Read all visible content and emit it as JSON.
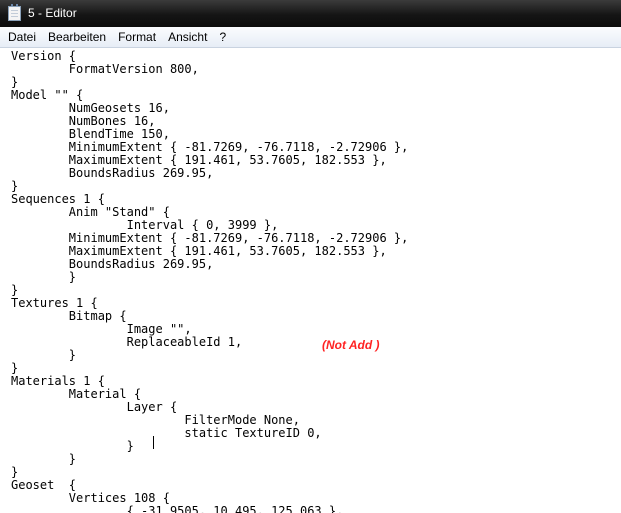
{
  "window": {
    "title": "5 - Editor"
  },
  "menu": [
    "Datei",
    "Bearbeiten",
    "Format",
    "Ansicht",
    "?"
  ],
  "editor_lines": [
    "Version {",
    "\tFormatVersion 800,",
    "}",
    "Model \"\" {",
    "\tNumGeosets 16,",
    "\tNumBones 16,",
    "\tBlendTime 150,",
    "\tMinimumExtent { -81.7269, -76.7118, -2.72906 },",
    "\tMaximumExtent { 191.461, 53.7605, 182.553 },",
    "\tBoundsRadius 269.95,",
    "}",
    "Sequences 1 {",
    "\tAnim \"Stand\" {",
    "\t\tInterval { 0, 3999 },",
    "\tMinimumExtent { -81.7269, -76.7118, -2.72906 },",
    "\tMaximumExtent { 191.461, 53.7605, 182.553 },",
    "\tBoundsRadius 269.95,",
    "\t}",
    "}",
    "Textures 1 {",
    "\tBitmap {",
    "\t\tImage \"\",",
    "\t\tReplaceableId 1,",
    "\t}",
    "}",
    "Materials 1 {",
    "\tMaterial {",
    "\t\tLayer {",
    "\t\t\tFilterMode None,",
    "\t\t\tstatic TextureID 0,",
    "\t\t}",
    "\t}",
    "}",
    "Geoset  {",
    "\tVertices 108 {",
    "\t\t{ -31.9505, 10.495, 125.063 },"
  ],
  "annotation": "(Not Add )"
}
